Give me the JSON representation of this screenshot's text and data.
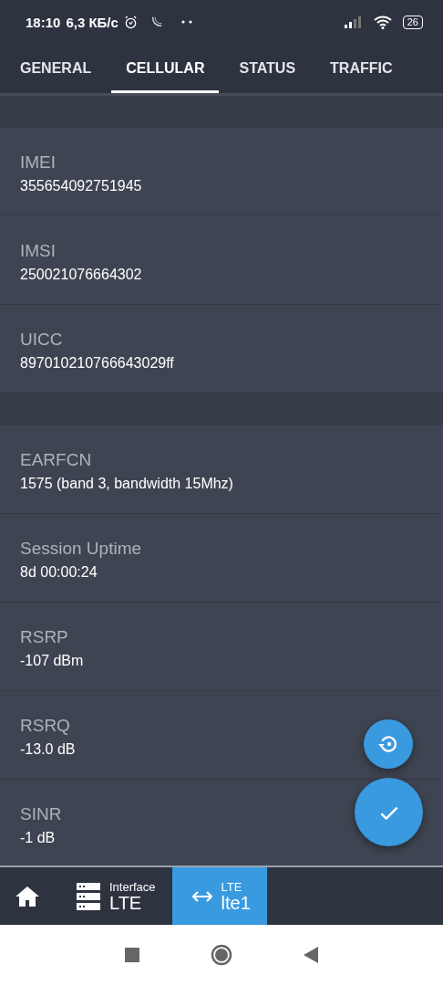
{
  "status_bar": {
    "time": "18:10",
    "speed": "6,3 КБ/с",
    "battery": "26"
  },
  "tabs": [
    {
      "label": "GENERAL",
      "selected": false
    },
    {
      "label": "CELLULAR",
      "selected": true
    },
    {
      "label": "STATUS",
      "selected": false
    },
    {
      "label": "TRAFFIC",
      "selected": false
    }
  ],
  "sections": [
    {
      "rows": [
        {
          "label": "IMEI",
          "value": "355654092751945"
        },
        {
          "label": "IMSI",
          "value": "250021076664302"
        },
        {
          "label": "UICC",
          "value": "897010210766643029ff"
        }
      ]
    },
    {
      "rows": [
        {
          "label": "EARFCN",
          "value": "1575 (band 3, bandwidth 15Mhz)"
        },
        {
          "label": "Session Uptime",
          "value": "8d 00:00:24"
        },
        {
          "label": "RSRP",
          "value": "-107 dBm"
        },
        {
          "label": "RSRQ",
          "value": "-13.0 dB"
        },
        {
          "label": "SINR",
          "value": "-1 dB"
        }
      ]
    }
  ],
  "breadcrumbs": [
    {
      "kind": "home",
      "selected": false
    },
    {
      "kind": "interface",
      "caption": "Interface",
      "label": "LTE",
      "selected": false
    },
    {
      "kind": "link",
      "caption": "LTE",
      "label": "lte1",
      "selected": true
    }
  ]
}
